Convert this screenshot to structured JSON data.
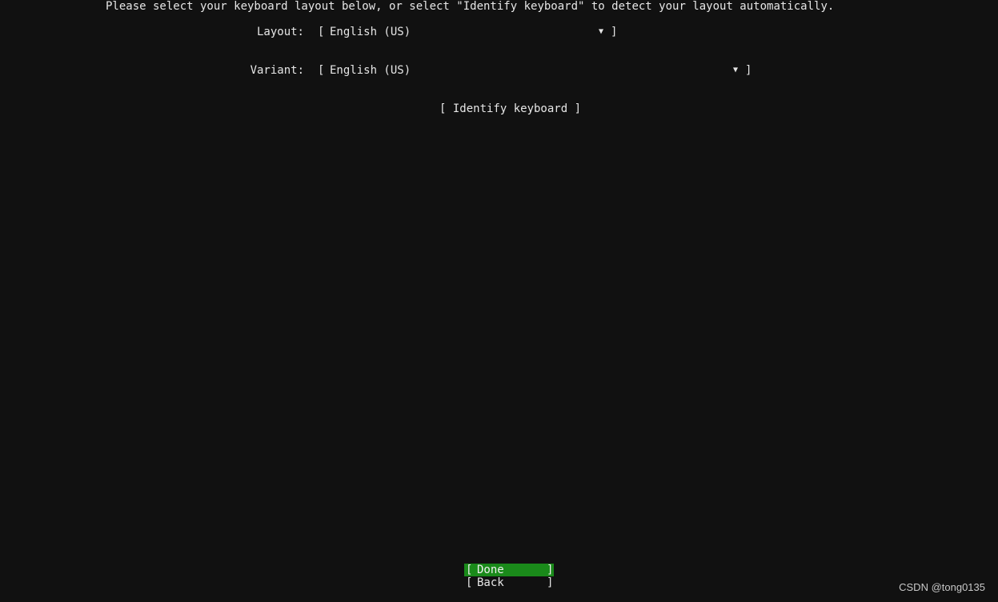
{
  "instruction": "Please select your keyboard layout below, or select \"Identify keyboard\" to detect your layout automatically.",
  "layout": {
    "label": "Layout:",
    "value": "English (US)",
    "open_bracket": "[",
    "close_bracket": "]",
    "arrow": "▼"
  },
  "variant": {
    "label": "Variant:",
    "value": "English (US)",
    "open_bracket": "[",
    "close_bracket": "]",
    "arrow": "▼"
  },
  "identify_button": "[ Identify keyboard ]",
  "footer": {
    "done": {
      "open": "[",
      "label": "Done",
      "close": "]"
    },
    "back": {
      "open": "[",
      "label": "Back",
      "close": "]"
    }
  },
  "watermark": "CSDN @tong0135",
  "colors": {
    "background": "#111111",
    "text": "#e6e6e6",
    "focus_highlight": "#1a8a1a"
  }
}
